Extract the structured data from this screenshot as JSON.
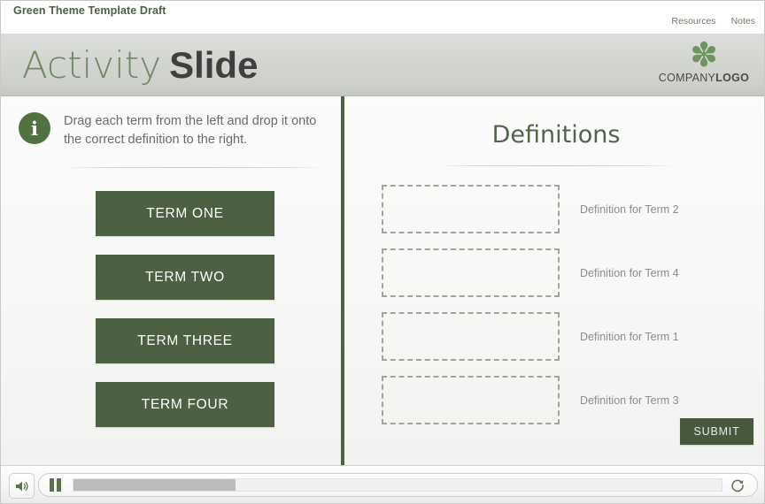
{
  "topbar": {
    "title": "Green Theme Template Draft",
    "links": [
      {
        "label": "Resources"
      },
      {
        "label": "Notes"
      }
    ]
  },
  "banner": {
    "title_light": "Activity",
    "title_bold": "Slide",
    "logo": {
      "mark_icon": "asterisk-icon",
      "mark_glyph": "✽",
      "text_thin": "COMPANY",
      "text_bold": "LOGO"
    }
  },
  "slide": {
    "instruction": {
      "icon": "info-icon",
      "icon_glyph": "i",
      "text": "Drag each term from the left and drop it onto the correct definition to the right."
    },
    "terms": [
      {
        "label": "TERM ONE"
      },
      {
        "label": "TERM TWO"
      },
      {
        "label": "TERM THREE"
      },
      {
        "label": "TERM FOUR"
      }
    ],
    "definitions_heading": "Definitions",
    "definitions": [
      {
        "label": "Definition for Term 2",
        "dropzone_value": ""
      },
      {
        "label": "Definition for Term 4",
        "dropzone_value": ""
      },
      {
        "label": "Definition for Term 1",
        "dropzone_value": ""
      },
      {
        "label": "Definition for Term 3",
        "dropzone_value": ""
      }
    ],
    "submit_label": "SUBMIT"
  },
  "controls": {
    "volume_icon": "speaker-icon",
    "pause_icon": "pause-icon",
    "replay_icon": "replay-icon",
    "progress_percent": 25
  },
  "colors": {
    "brand_green": "#4c6043",
    "accent_green": "#6f9460",
    "heading_green": "#51654a",
    "banner_gray": "#d3d5d1",
    "dropzone_border": "#9aa895",
    "muted_text": "#8d8d8d"
  }
}
